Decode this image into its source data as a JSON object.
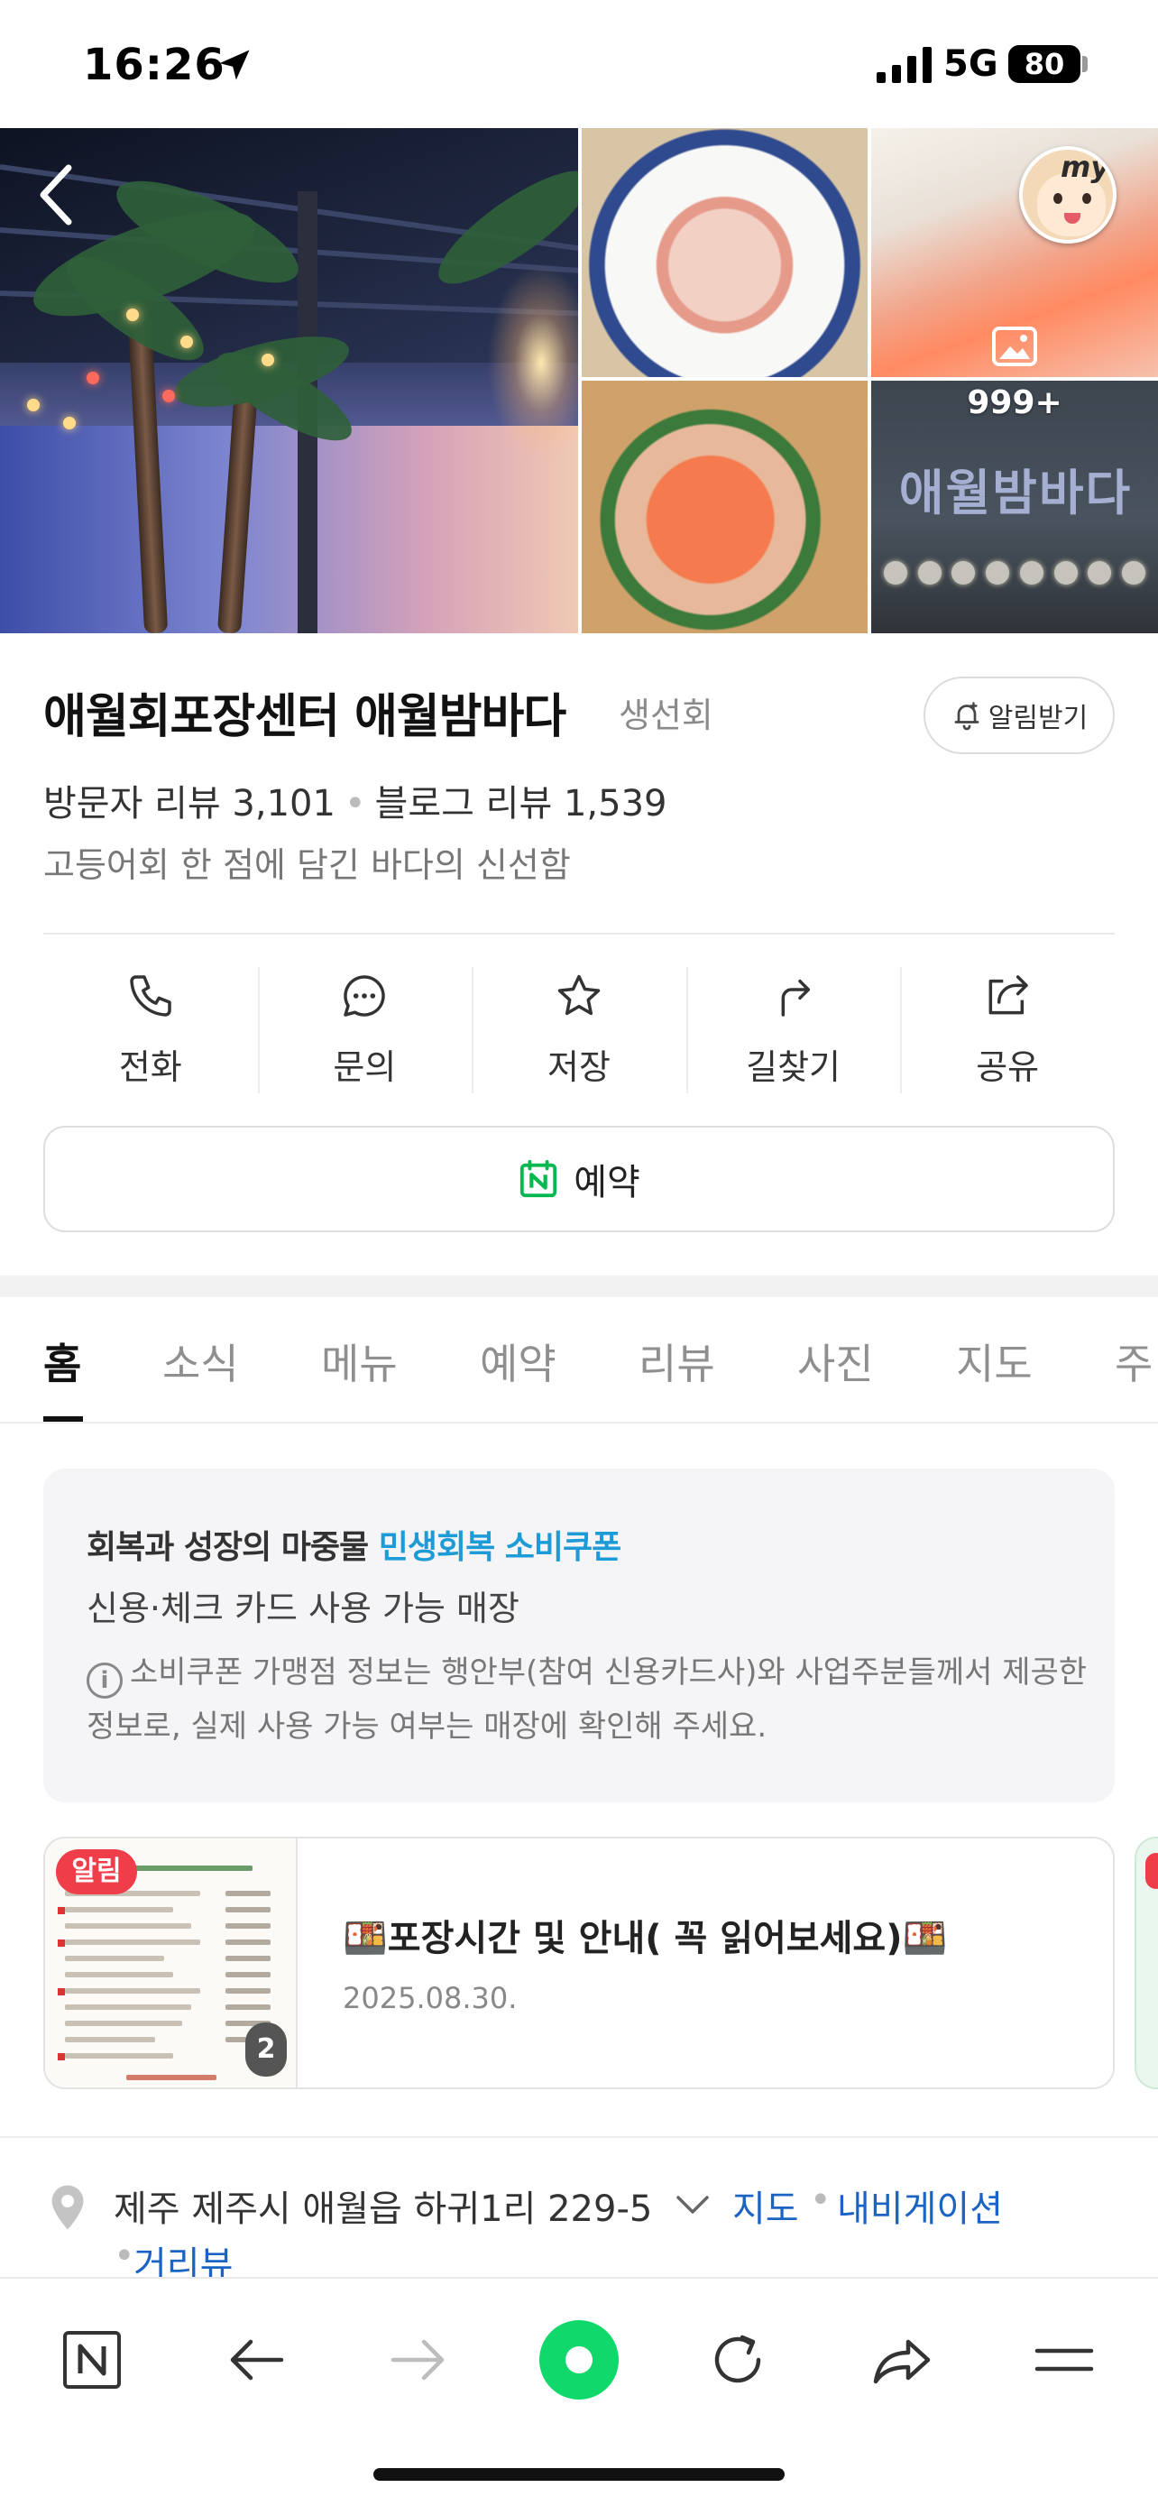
{
  "status_bar": {
    "time": "16:26",
    "network": "5G",
    "battery": "80"
  },
  "gallery": {
    "more_count": "999+",
    "sign_text": "애월밤바다",
    "my_badge": "my"
  },
  "place": {
    "name": "애월회포장센터 애월밤바다",
    "category": "생선회",
    "notify_label": "알림받기",
    "visitor_reviews": "방문자 리뷰 3,101",
    "blog_reviews": "블로그 리뷰 1,539",
    "tagline": "고등어회 한 점에 담긴 바다의 신선함"
  },
  "actions": [
    {
      "label": "전화",
      "icon": "phone-icon"
    },
    {
      "label": "문의",
      "icon": "chat-icon"
    },
    {
      "label": "저장",
      "icon": "star-icon"
    },
    {
      "label": "길찾기",
      "icon": "directions-icon"
    },
    {
      "label": "공유",
      "icon": "share-icon"
    }
  ],
  "reserve": {
    "label": "예약",
    "icon": "naver-calendar-icon"
  },
  "tabs": [
    "홈",
    "소식",
    "메뉴",
    "예약",
    "리뷰",
    "사진",
    "지도",
    "주"
  ],
  "active_tab": 0,
  "coupon": {
    "title_prefix": "회복과 성장의 마중물",
    "title_highlight": "민생회복 소비쿠폰",
    "subtitle": "신용·체크 카드 사용 가능 매장",
    "note": "소비쿠폰 가맹점 정보는 행안부(참여 신용카드사)와 사업주분들께서 제공한 정보로, 실제 사용 가능 여부는 매장에 확인해 주세요."
  },
  "notice": {
    "badge": "알림",
    "image_count": "2",
    "title": "🍱포장시간 및 안내( 꼭 읽어보세요)🍱",
    "date": "2025.08.30."
  },
  "address": {
    "text": "제주 제주시 애월읍 하귀1리 229-5",
    "map_link": "지도",
    "navi_link": "내비게이션",
    "street_link": "거리뷰"
  },
  "colors": {
    "accent_blue": "#1b64c4",
    "coupon_highlight": "#1d9bd7",
    "alert_red": "#ef3d4a",
    "naver_green": "#10d86a"
  }
}
